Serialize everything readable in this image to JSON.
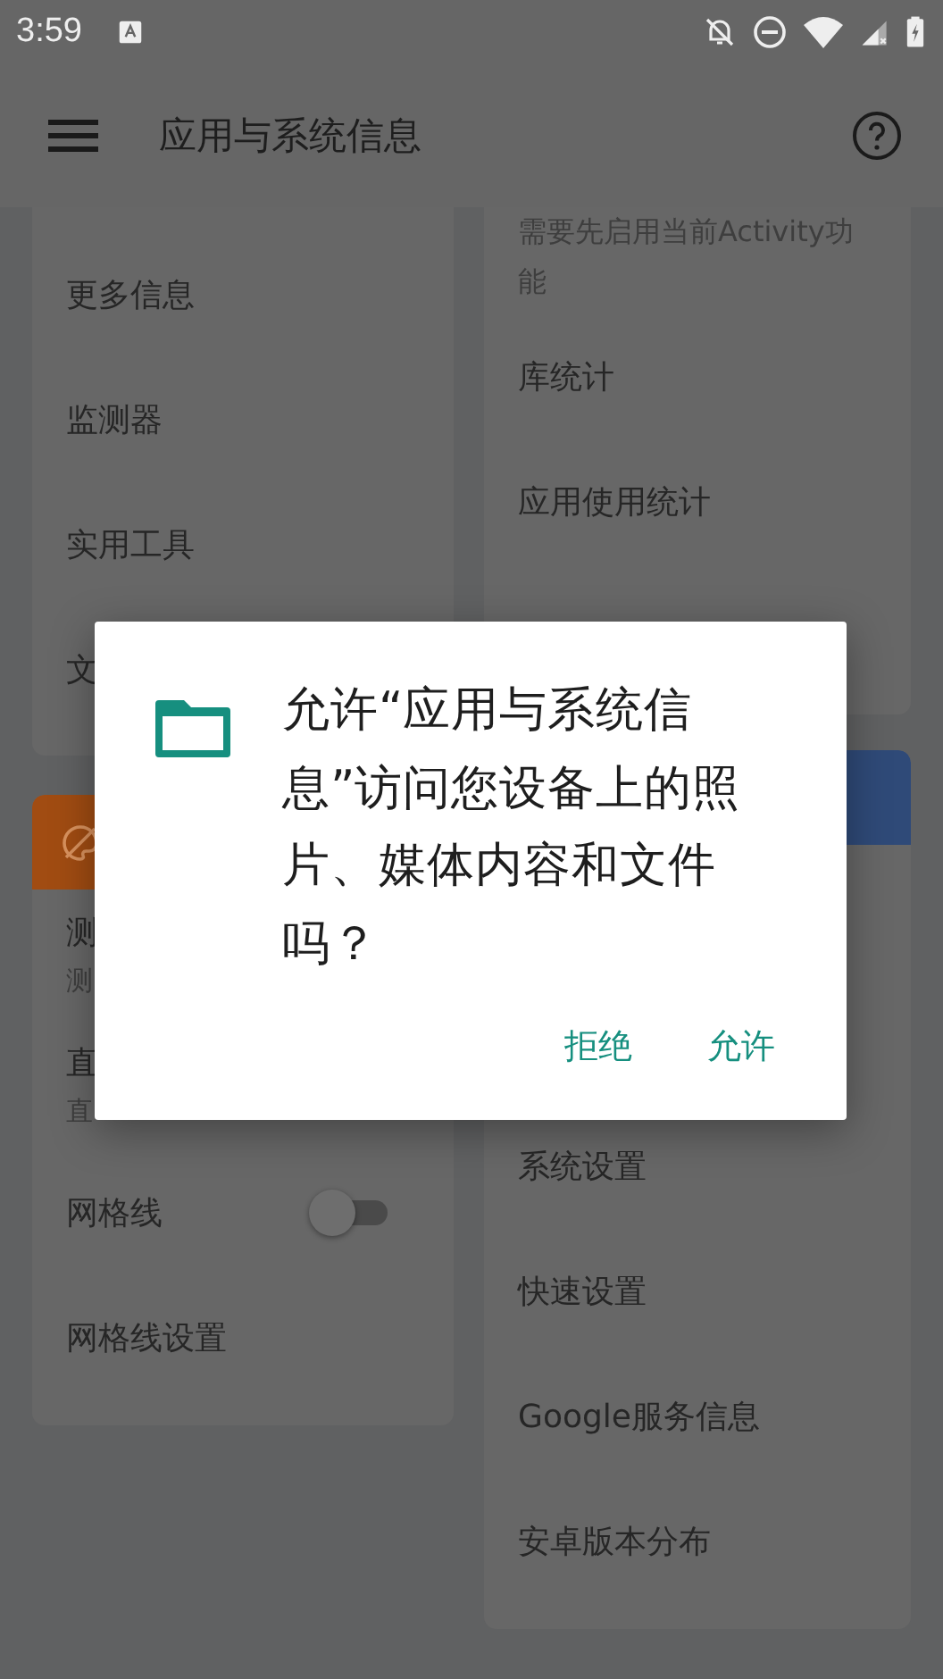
{
  "status_bar": {
    "time": "3:59"
  },
  "app_bar": {
    "title": "应用与系统信息"
  },
  "left_cards": [
    {
      "items": [
        {
          "kind": "link",
          "label": "更多信息"
        },
        {
          "kind": "link",
          "label": "监测器"
        },
        {
          "kind": "link",
          "label": "实用工具"
        },
        {
          "kind": "link",
          "label": "文"
        }
      ]
    },
    {
      "color": "#a14c12",
      "items": [
        {
          "kind": "link",
          "label": "测",
          "subtitle": "测"
        },
        {
          "kind": "link",
          "label": "直",
          "subtitle": "直"
        },
        {
          "kind": "toggle",
          "label": "网格线",
          "checked": false
        },
        {
          "kind": "link",
          "label": "网格线设置"
        }
      ]
    }
  ],
  "right_cards": [
    {
      "items": [
        {
          "kind": "note",
          "label": "需要先启用当前Activity功能"
        },
        {
          "kind": "link",
          "label": "库统计"
        },
        {
          "kind": "link",
          "label": "应用使用统计"
        }
      ]
    },
    {
      "color": "#2f4a78",
      "items": [
        {
          "kind": "link",
          "label": "系统设置"
        },
        {
          "kind": "link",
          "label": "快速设置"
        },
        {
          "kind": "link",
          "label": "Google服务信息"
        },
        {
          "kind": "link",
          "label": "安卓版本分布"
        }
      ]
    }
  ],
  "dialog": {
    "message": "允许“应用与系统信息”访问您设备上的照片、媒体内容和文件吗？",
    "buttons": [
      "拒绝",
      "允许"
    ]
  }
}
